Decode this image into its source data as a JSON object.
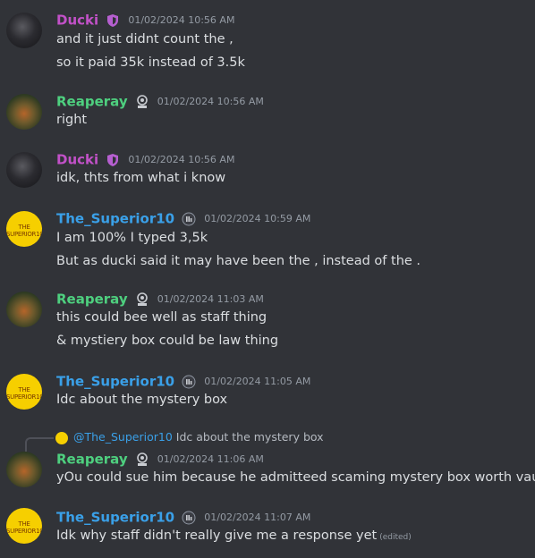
{
  "users": {
    "ducki": {
      "name": "Ducki",
      "color": "#c251c8",
      "icon": "shield-badge-icon"
    },
    "reaperay": {
      "name": "Reaperay",
      "color": "#4ed07f",
      "icon": "rcc-server-tag-icon"
    },
    "superior": {
      "name": "The_Superior10",
      "color": "#3aa0e8",
      "icon": "server-tag-icon",
      "avatar_text": "THE SUPERIOR10"
    }
  },
  "messages": [
    {
      "ts": "01/02/2024 10:56 AM",
      "lines": [
        "and it just didnt count the ,",
        "so it paid 35k instead of 3.5k"
      ]
    },
    {
      "ts": "01/02/2024 10:56 AM",
      "lines": [
        "right"
      ]
    },
    {
      "ts": "01/02/2024 10:56 AM",
      "lines": [
        "idk, thts from what i know"
      ]
    },
    {
      "ts": "01/02/2024 10:59 AM",
      "lines": [
        "I am 100% I typed 3,5k",
        "But as ducki said it may have been the , instead of the ."
      ]
    },
    {
      "ts": "01/02/2024 11:03 AM",
      "lines": [
        "this could bee well as staff thing",
        "& mystiery box could be law thing"
      ]
    },
    {
      "ts": "01/02/2024 11:05 AM",
      "lines": [
        "Idc about the mystery box"
      ]
    },
    {
      "ts": "01/02/2024 11:06 AM",
      "reply": {
        "name": "@The_Superior10",
        "text": "Idc about the mystery box"
      },
      "lines": [
        "yOu could sue him because he admitteed scaming mystery box worth vaule"
      ]
    },
    {
      "ts": "01/02/2024 11:07 AM",
      "lines": [
        "Idk why staff didn't really give me a response yet"
      ],
      "edited": "(edited)"
    }
  ],
  "badge_text": {
    "rcc": "RCC"
  }
}
